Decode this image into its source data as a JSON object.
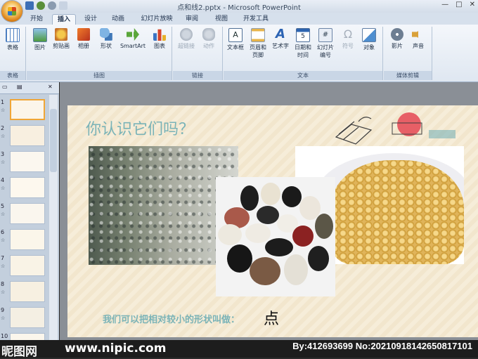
{
  "window": {
    "title": "点和线2.pptx - Microsoft PowerPoint",
    "controls": [
      "—",
      "□",
      "✕"
    ]
  },
  "tabs": [
    "开始",
    "插入",
    "设计",
    "动画",
    "幻灯片放映",
    "审阅",
    "视图",
    "开发工具"
  ],
  "active_tab": "插入",
  "ribbon": {
    "table_group": {
      "label": "表格",
      "buttons": [
        {
          "label": "表格",
          "icon": "table-icon"
        }
      ]
    },
    "illustrations_group": {
      "label": "插图",
      "buttons": [
        {
          "label": "图片",
          "icon": "picture-icon"
        },
        {
          "label": "剪贴画",
          "icon": "clipart-icon"
        },
        {
          "label": "相册",
          "icon": "photo-album-icon"
        },
        {
          "label": "形状",
          "icon": "shapes-icon"
        },
        {
          "label": "SmartArt",
          "icon": "smartart-icon"
        },
        {
          "label": "图表",
          "icon": "chart-icon"
        }
      ]
    },
    "links_group": {
      "label": "链接",
      "buttons": [
        {
          "label": "超链接",
          "icon": "hyperlink-icon"
        },
        {
          "label": "动作",
          "icon": "action-icon"
        }
      ]
    },
    "text_group": {
      "label": "文本",
      "buttons": [
        {
          "label": "文本框",
          "icon": "textbox-icon"
        },
        {
          "label": "页眉和",
          "sub": "页脚",
          "icon": "header-footer-icon"
        },
        {
          "label": "艺术字",
          "icon": "wordart-icon"
        },
        {
          "label": "日期和",
          "sub": "时间",
          "icon": "date-time-icon"
        },
        {
          "label": "幻灯片",
          "sub": "编号",
          "icon": "slide-number-icon"
        },
        {
          "label": "符号",
          "icon": "symbol-icon"
        },
        {
          "label": "对象",
          "icon": "object-icon"
        }
      ]
    },
    "media_group": {
      "label": "媒体剪辑",
      "buttons": [
        {
          "label": "影片",
          "icon": "movie-icon"
        },
        {
          "label": "声音",
          "icon": "sound-icon"
        }
      ]
    }
  },
  "slide_panel": {
    "slides": [
      "1",
      "2",
      "3",
      "4",
      "5",
      "6",
      "7",
      "8",
      "9",
      "10"
    ],
    "selected": 1
  },
  "slide": {
    "title": "你认识它们吗？",
    "caption": "我们可以把相对较小的形状叫做：",
    "answer": "点"
  },
  "watermark": {
    "left": "昵图网",
    "site": "www.nipic.com",
    "right": "By:412693699 No:20210918142650817101"
  },
  "colors": {
    "accent": "#7ab3b7",
    "selected_thumb": "#f0a637"
  }
}
